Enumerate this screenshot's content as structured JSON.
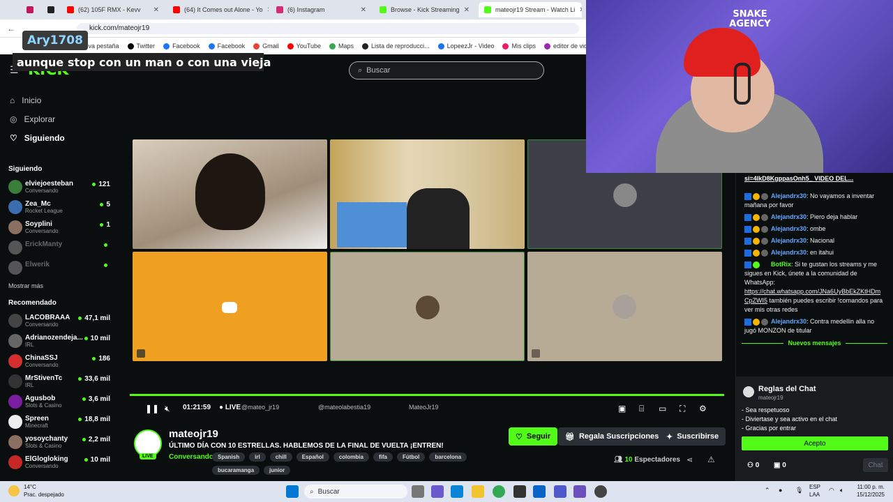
{
  "browser": {
    "tabs": [
      {
        "label": "",
        "color": "#c2185b"
      },
      {
        "label": "",
        "color": "#222222"
      },
      {
        "label": "(62) 105F RMX - Kevv",
        "color": "#ff0000"
      },
      {
        "label": "(64) It Comes out Alone - Yo",
        "color": "#ff0000"
      },
      {
        "label": "(6) Instagram",
        "color": "#d62976"
      },
      {
        "label": "Browse - Kick Streaming",
        "color": "#53fc18"
      },
      {
        "label": "mateojr19 Stream - Watch Li",
        "color": "#53fc18"
      }
    ],
    "url": "kick.com/mateojr19",
    "bookmarks": [
      "Nueva pestaña",
      "Twitter",
      "Facebook",
      "Facebook",
      "Gmail",
      "YouTube",
      "Maps",
      "Lista de reproducci...",
      "LopeezJr - Video",
      "Mis clips",
      "editor de videos onl"
    ]
  },
  "overlay": {
    "name": "Ary1708",
    "caption": "aunque stop con un man o con una vieja"
  },
  "header": {
    "logo": "KICK",
    "search_placeholder": "Buscar"
  },
  "sidebar": {
    "nav": [
      {
        "label": "Inicio"
      },
      {
        "label": "Explorar"
      },
      {
        "label": "Siguiendo"
      }
    ],
    "following_title": "Siguiendo",
    "following": [
      {
        "name": "elviejoesteban",
        "category": "Conversando",
        "viewers": "121",
        "color": "#3b7d3b"
      },
      {
        "name": "Zea_Mc",
        "category": "Rocket League",
        "viewers": "5",
        "color": "#3b6db0"
      },
      {
        "name": "Soyplini",
        "category": "Conversando",
        "viewers": "1",
        "color": "#8d6e63"
      },
      {
        "name": "ErickManty",
        "category": "",
        "viewers": "",
        "color": "#555"
      },
      {
        "name": "Elwerik",
        "category": "",
        "viewers": "",
        "color": "#555"
      }
    ],
    "show_more": "Mostrar más",
    "recommended_title": "Recomendado",
    "recommended": [
      {
        "name": "LACOBRAAA",
        "category": "Conversando",
        "viewers": "47,1 mil",
        "color": "#444"
      },
      {
        "name": "Adrianozendeja...",
        "category": "IRL",
        "viewers": "10 mil",
        "color": "#666"
      },
      {
        "name": "ChinaSSJ",
        "category": "Conversando",
        "viewers": "186",
        "color": "#d32f2f"
      },
      {
        "name": "MrStivenTc",
        "category": "IRL",
        "viewers": "33,6 mil",
        "color": "#333"
      },
      {
        "name": "Agusbob",
        "category": "Slots & Casino",
        "viewers": "3,6 mil",
        "color": "#7b1fa2"
      },
      {
        "name": "Spreen",
        "category": "Minecraft",
        "viewers": "18,8 mil",
        "color": "#eee"
      },
      {
        "name": "yosoychanty",
        "category": "Slots & Casino",
        "viewers": "2,2 mil",
        "color": "#8d6e63"
      },
      {
        "name": "ElGlogloking",
        "category": "Conversando",
        "viewers": "10 mil",
        "color": "#c62828"
      }
    ]
  },
  "player": {
    "time": "01:21:59",
    "live": "LIVE",
    "socials": [
      "@mateo_jr19",
      "@mateolabestia19",
      "MateoJr19"
    ],
    "tile_colors": {
      "orange": "#f0a020",
      "beige": "#b7ab96",
      "gray": "#3d4048"
    }
  },
  "stream": {
    "channel": "mateojr19",
    "title": "ÚLTIMO DÍA CON 10 ESTRELLAS. HABLEMOS DE LA FINAL DE VUELTA ¡ENTREN!",
    "category": "Conversando",
    "tags": [
      "Spanish",
      "irl",
      "chill",
      "Español",
      "colombia",
      "fifa",
      "Fútbol",
      "barcelona",
      "bucaramanga",
      "junior"
    ],
    "follow": "Seguir",
    "gift": "Regala Suscripciones",
    "subscribe": "Suscribirse",
    "viewers_count": "10",
    "viewers_label": "Espectadores",
    "avatar_badge": "LIVE"
  },
  "chat": {
    "link_top": "si=4IkD8KgppasOnh5_ VIDEO DEL...",
    "messages": [
      {
        "user": "Alejandrx30",
        "text": ": No vayamos a inventar mañana por favor"
      },
      {
        "user": "Alejandrx30",
        "text": ": Piero deja hablar"
      },
      {
        "user": "Alejandrx30",
        "text": ": ombe"
      },
      {
        "user": "Alejandrx30",
        "text": ": Nacional"
      },
      {
        "user": "Alejandrx30",
        "text": ": en itahui"
      }
    ],
    "bot": {
      "user": "BotRix",
      "text": ": Si te gustan los streams y me sigues en Kick, únete a la comunidad de WhatsApp:",
      "link": "https://chat.whatsapp.com/JNa6UyBbEkZKtHDmCpZWI5",
      "tail": " también puedes escribir !comandos para ver mis otras redes"
    },
    "last": {
      "user": "Alejandrx30",
      "text": ": Contra medellin alla no jugó MONZON de titular"
    },
    "new_messages": "Nuevos mensajes",
    "rules_title": "Reglas del Chat",
    "rules_channel": "mateojr19",
    "rules": [
      "- Sea respetuoso",
      "- Diviertase y sea activo en el chat",
      "- Gracias por entrar"
    ],
    "accept": "Acepto",
    "count_a": "0",
    "count_b": "0",
    "chat_button": "Chat"
  },
  "webcam": {
    "watermark": "SNAKE AGENCY"
  },
  "taskbar": {
    "temp": "14°C",
    "weather": "Prac. despejado",
    "search": "Buscar",
    "lang": "ESP",
    "lang2": "LAA",
    "time": "11:00 p. m.",
    "date": "15/12/2025"
  }
}
